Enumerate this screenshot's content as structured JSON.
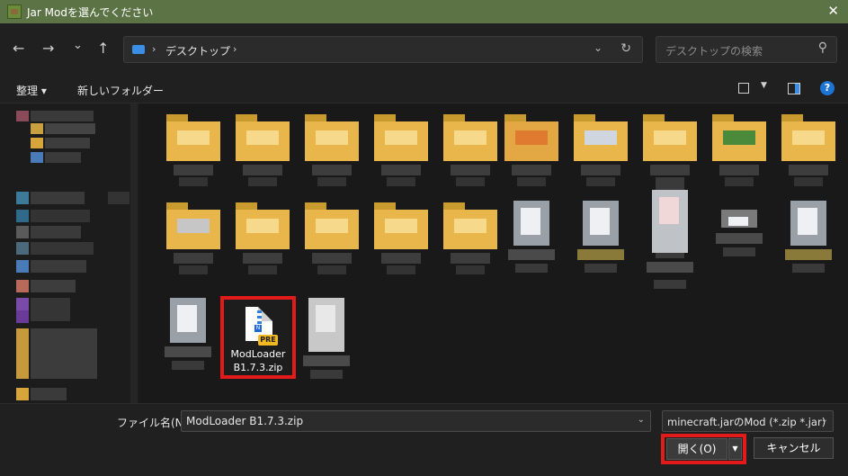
{
  "window": {
    "title": "Jar Modを選んでください",
    "close_glyph": "✕"
  },
  "nav": {
    "back_glyph": "←",
    "forward_glyph": "→",
    "recent_glyph": "⌄",
    "up_glyph": "↑"
  },
  "address": {
    "separator": "›",
    "crumb": "デスクトップ",
    "dropdown_glyph": "⌄",
    "refresh_glyph": "↻"
  },
  "search": {
    "placeholder": "デスクトップの検索",
    "icon_glyph": "⚲"
  },
  "toolbar": {
    "organize_label": "整理 ▾",
    "new_folder_label": "新しいフォルダー",
    "view_dropdown_glyph": "▼",
    "help_glyph": "?"
  },
  "selected_file": {
    "badge": "PRE",
    "n_glyph": "N",
    "name_line1": "ModLoader",
    "name_line2": "B1.7.3.zip"
  },
  "footer": {
    "filename_label": "ファイル名(N):",
    "filename_value": "ModLoader B1.7.3.zip",
    "filetype_value": "minecraft.jarのMod (*.zip *.jar)",
    "dropdown_glyph": "⌄",
    "open_label": "開く(O)",
    "open_arrow": "▼",
    "cancel_label": "キャンセル"
  },
  "colors": {
    "titlebar": "#5c7346",
    "accent": "#1e73d6",
    "highlight_box": "#e21a1a",
    "folder_yellow": "#e8b64a"
  },
  "icons": [
    "app-icon",
    "close-icon",
    "back-arrow-icon",
    "forward-arrow-icon",
    "chevron-down-icon",
    "up-arrow-icon",
    "desktop-icon",
    "refresh-icon",
    "search-icon",
    "view-icon",
    "preview-pane-icon",
    "help-icon",
    "zip-file-icon",
    "folder-icon"
  ]
}
